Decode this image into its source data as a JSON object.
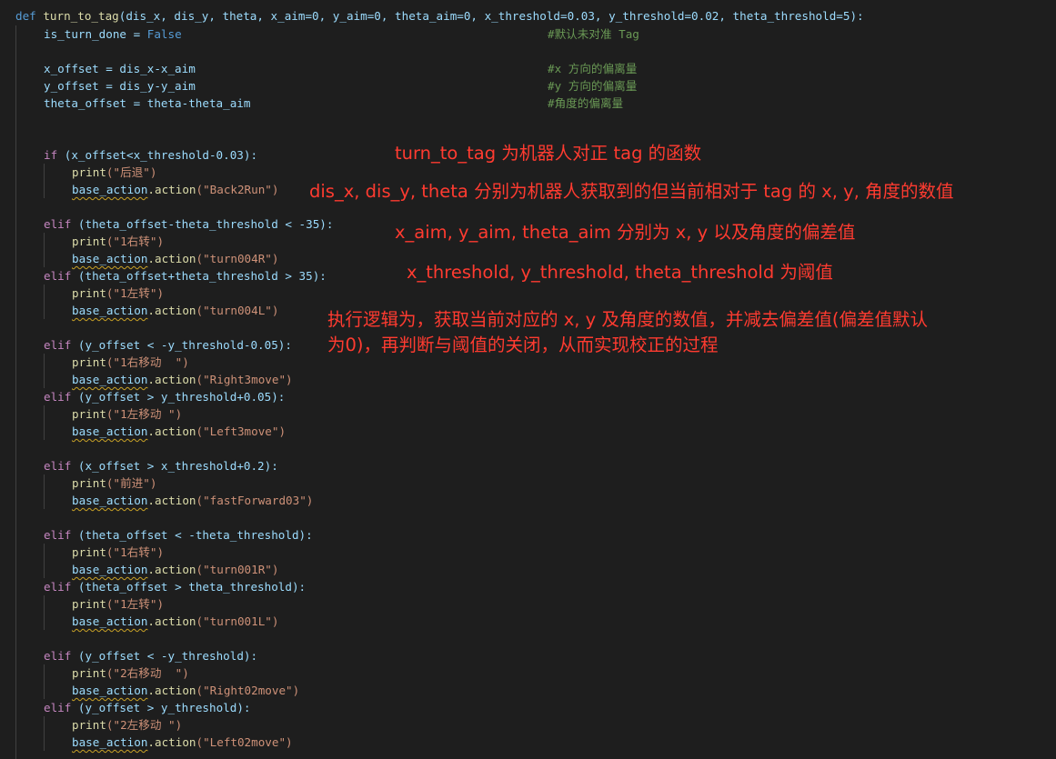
{
  "code": {
    "def_kw": "def",
    "func_name": "turn_to_tag",
    "params": "(dis_x, dis_y, theta, x_aim=0, y_aim=0, theta_aim=0, x_threshold=0.03, y_threshold=0.02, theta_threshold=5):",
    "l1_code": "is_turn_done = ",
    "l1_val": "False",
    "l1_comment": "#默认未对准 Tag",
    "l2_code": "x_offset = dis_x-x_aim",
    "l2_comment": "#x 方向的偏离量",
    "l3_code": "y_offset = dis_y-y_aim",
    "l3_comment": "#y 方向的偏离量",
    "l4_code": "theta_offset = theta-theta_aim",
    "l4_comment": "#角度的偏离量",
    "if_kw": "if",
    "elif_kw": "elif",
    "print_fn": "print",
    "base_action": "base_action",
    "action_fn": ".action",
    "cond1": " (x_offset<x_threshold-0.03):",
    "p1": "(\"后退\")",
    "a1": "(\"Back2Run\")",
    "cond2": " (theta_offset-theta_threshold < -35):",
    "p2": "(\"1右转\")",
    "a2": "(\"turn004R\")",
    "cond3": " (theta_offset+theta_threshold > 35):",
    "p3": "(\"1左转\")",
    "a3": "(\"turn004L\")",
    "cond4": " (y_offset < -y_threshold-0.05):",
    "p4": "(\"1右移动  \")",
    "a4": "(\"Right3move\")",
    "cond5": " (y_offset > y_threshold+0.05):",
    "p5": "(\"1左移动 \")",
    "a5": "(\"Left3move\")",
    "cond6": " (x_offset > x_threshold+0.2):",
    "p6": "(\"前进\")",
    "a6": "(\"fastForward03\")",
    "cond7": " (theta_offset < -theta_threshold):",
    "p7": "(\"1右转\")",
    "a7": "(\"turn001R\")",
    "cond8": " (theta_offset > theta_threshold):",
    "p8": "(\"1左转\")",
    "a8": "(\"turn001L\")",
    "cond9": " (y_offset < -y_threshold):",
    "p9": "(\"2右移动  \")",
    "a9": "(\"Right02move\")",
    "cond10": " (y_offset > y_threshold):",
    "p10": "(\"2左移动 \")",
    "a10": "(\"Left02move\")"
  },
  "annotations": {
    "n1": "turn_to_tag 为机器人对正 tag 的函数",
    "n2": "dis_x, dis_y, theta 分别为机器人获取到的但当前相对于 tag 的 x, y, 角度的数值",
    "n3": "x_aim, y_aim, theta_aim 分别为 x, y 以及角度的偏差值",
    "n4": "x_threshold, y_threshold, theta_threshold 为阈值",
    "n5_line1": "执行逻辑为，获取当前对应的 x, y 及角度的数值，并减去偏差值(偏差值默认",
    "n5_line2": "为0)，再判断与阈值的关闭，从而实现校正的过程"
  },
  "colors": {
    "background": "#1e1e1e",
    "keyword": "#569cd6",
    "control": "#c586c0",
    "function": "#dcdcaa",
    "variable": "#9cdcfe",
    "number": "#b5cea8",
    "string": "#ce9178",
    "comment": "#6a9955",
    "annotation": "#ff3b30"
  }
}
